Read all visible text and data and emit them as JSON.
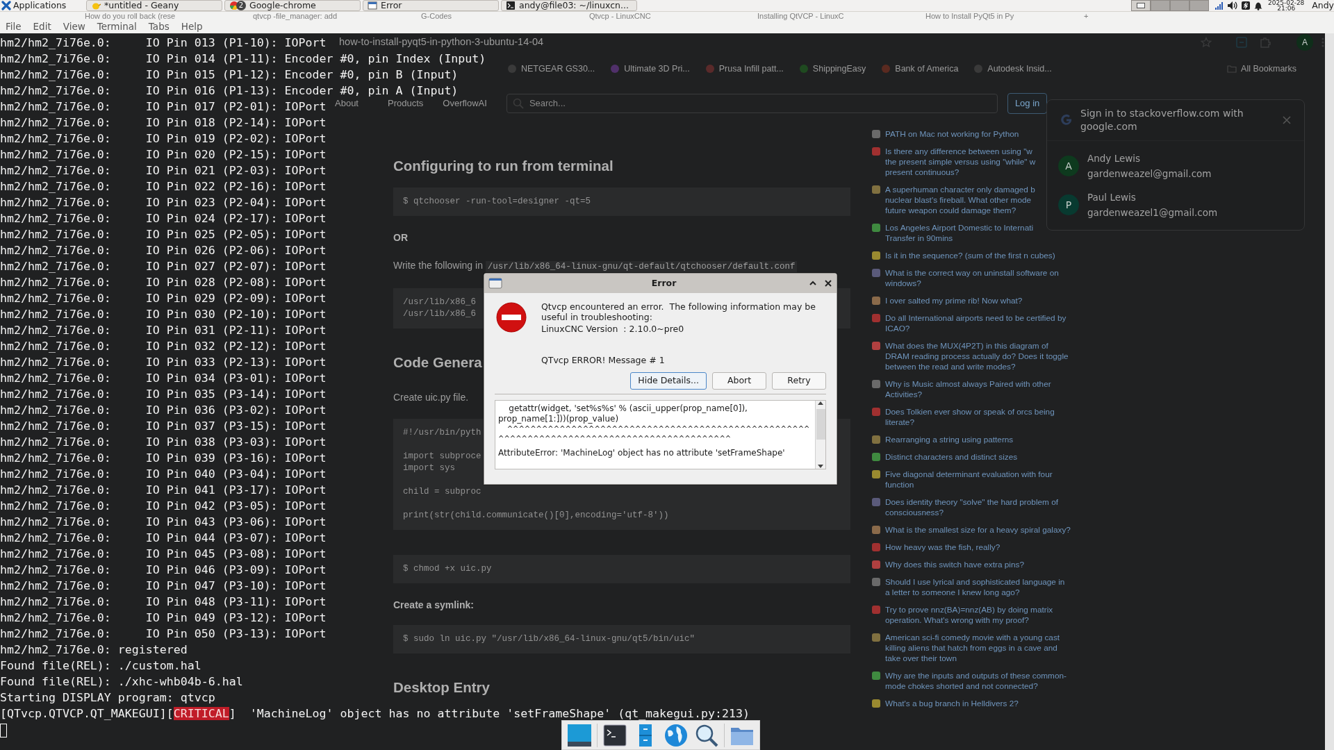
{
  "panel": {
    "menu_label": "Applications",
    "windows": [
      {
        "kind": "editor",
        "title": "*untitled - Geany"
      },
      {
        "kind": "browser",
        "title": "Google-chrome",
        "count": "2"
      },
      {
        "kind": "dialog",
        "title": "Error"
      },
      {
        "kind": "terminal",
        "title": "andy@file03: ~/linuxcn..."
      }
    ],
    "workspaces": [
      {
        "selected": true
      },
      {
        "selected": false
      },
      {
        "selected": false
      },
      {
        "selected": false
      }
    ],
    "date": "2025-02-28",
    "time": "21:06",
    "user": "Andy"
  },
  "browser": {
    "tabs": [
      "How do you roll back (rese",
      "qtvcp -file_manager: add",
      "G-Codes",
      "Qtvcp - LinuxCNC",
      "Installing QtVCP - LinuxC",
      "How to Install PyQt5 in Py"
    ],
    "new_tab": "+",
    "url": "how-to-install-pyqt5-in-python-3-ubuntu-14-04",
    "profile_initial": "A",
    "bookmarks": [
      "NETGEAR GS30...",
      "Ultimate 3D Pri...",
      "Prusa Infill patt...",
      "ShippingEasy",
      "Bank of America",
      "Autodesk Insid..."
    ],
    "all_bookmarks": "All Bookmarks",
    "site_nav": [
      "About",
      "Products",
      "OverflowAI"
    ],
    "search": {
      "placeholder": "Search..."
    },
    "login": "Log in",
    "article": [
      {
        "kind": "heading",
        "text": "Configuring to run from terminal"
      },
      {
        "kind": "code",
        "groups": [
          [
            "$ qtchooser -run-tool=designer -qt=5"
          ]
        ]
      },
      {
        "kind": "bold",
        "text": "OR"
      },
      {
        "kind": "paragraph",
        "text": "Write the following in ",
        "code": "/usr/lib/x86_64-linux-gnu/qt-default/qtchooser/default.conf"
      },
      {
        "kind": "code",
        "groups": [
          [
            "/usr/lib/x86_6",
            "/usr/lib/x86_6"
          ]
        ]
      },
      {
        "kind": "heading",
        "text": "Code Genera"
      },
      {
        "kind": "paragraph",
        "text": "Create uic.py file."
      },
      {
        "kind": "code",
        "groups": [
          [
            "#!/usr/bin/pyth"
          ],
          [
            "import subproce",
            "import sys"
          ],
          [
            "child = subproc"
          ],
          [
            "print(str(child.communicate()[0],encoding='utf-8'))"
          ]
        ]
      },
      {
        "kind": "code",
        "groups": [
          [
            "$ chmod +x uic.py"
          ]
        ]
      },
      {
        "kind": "bold",
        "text": "Create a symlink:"
      },
      {
        "kind": "code",
        "groups": [
          [
            "$ sudo ln uic.py \"/usr/lib/x86_64-linux-gnu/qt5/bin/uic\""
          ]
        ]
      },
      {
        "kind": "heading",
        "text": "Desktop Entry"
      }
    ],
    "related": [
      "PATH on Mac not working for Python",
      "Is there any difference between using \"w\nthe present simple versus using \"while\" w\npresent continuous?",
      "A superhuman character only damaged b\nnuclear blast's fireball. What other mode\nfuture weapon could damage them?",
      "Los Angeles Airport Domestic to Internati\nTransfer in 90mins",
      "Is it in the sequence? (sum of the first n cubes)",
      "What is the correct way on uninstall software on windows?",
      "I over salted my prime rib! Now what?",
      "Do all International airports need to be certified by ICAO?",
      "What does the MUX(4P2T) in this diagram of DRAM reading process actually do? Does it toggle between the read and write modes?",
      "Why is Music almost always Paired with other Activities?",
      "Does Tolkien ever show or speak of orcs being literate?",
      "Rearranging a string using patterns",
      "Distinct characters and distinct sizes",
      "Five diagonal determinant evaluation with four function",
      "Does identity theory \"solve\" the hard problem of consciousness?",
      "What is the smallest size for a heavy spiral galaxy?",
      "How heavy was the fish, really?",
      "Why does this switch have extra pins?",
      "Should I use lyrical and sophisticated language in a letter to someone I knew long ago?",
      "Try to prove nnz(BA)=nnz(AB) by doing matrix operation. What's wrong with my proof?",
      "American sci-fi comedy movie with a young cast killing aliens that hatch from eggs in a cave and take over their town",
      "Why are the inputs and outputs of these common-mode chokes shorted and not connected?",
      "What's a bug branch in Helldivers 2?"
    ],
    "signin": {
      "title": "Sign in to stackoverflow.com with google.com",
      "accounts": [
        {
          "initial": "A",
          "name": "Andy Lewis",
          "email": "gardenweazel@gmail.com",
          "color": "#0e3a1e"
        },
        {
          "initial": "P",
          "name": "Paul Lewis",
          "email": "gardenweazel1@gmail.com",
          "color": "#083a30"
        }
      ]
    }
  },
  "terminal": {
    "menu": [
      "File",
      "Edit",
      "View",
      "Terminal",
      "Tabs",
      "Help"
    ],
    "lines": [
      {
        "text": "hm2/hm2_7i76e.0:     IO Pin 013 (P1-10): IOPort"
      },
      {
        "text": "hm2/hm2_7i76e.0:     IO Pin 014 (P1-11): Encoder #0, pin Index (Input)"
      },
      {
        "text": "hm2/hm2_7i76e.0:     IO Pin 015 (P1-12): Encoder #0, pin B (Input)"
      },
      {
        "text": "hm2/hm2_7i76e.0:     IO Pin 016 (P1-13): Encoder #0, pin A (Input)"
      },
      {
        "text": "hm2/hm2_7i76e.0:     IO Pin 017 (P2-01): IOPort"
      },
      {
        "text": "hm2/hm2_7i76e.0:     IO Pin 018 (P2-14): IOPort"
      },
      {
        "text": "hm2/hm2_7i76e.0:     IO Pin 019 (P2-02): IOPort"
      },
      {
        "text": "hm2/hm2_7i76e.0:     IO Pin 020 (P2-15): IOPort"
      },
      {
        "text": "hm2/hm2_7i76e.0:     IO Pin 021 (P2-03): IOPort"
      },
      {
        "text": "hm2/hm2_7i76e.0:     IO Pin 022 (P2-16): IOPort"
      },
      {
        "text": "hm2/hm2_7i76e.0:     IO Pin 023 (P2-04): IOPort"
      },
      {
        "text": "hm2/hm2_7i76e.0:     IO Pin 024 (P2-17): IOPort"
      },
      {
        "text": "hm2/hm2_7i76e.0:     IO Pin 025 (P2-05): IOPort"
      },
      {
        "text": "hm2/hm2_7i76e.0:     IO Pin 026 (P2-06): IOPort"
      },
      {
        "text": "hm2/hm2_7i76e.0:     IO Pin 027 (P2-07): IOPort"
      },
      {
        "text": "hm2/hm2_7i76e.0:     IO Pin 028 (P2-08): IOPort"
      },
      {
        "text": "hm2/hm2_7i76e.0:     IO Pin 029 (P2-09): IOPort"
      },
      {
        "text": "hm2/hm2_7i76e.0:     IO Pin 030 (P2-10): IOPort"
      },
      {
        "text": "hm2/hm2_7i76e.0:     IO Pin 031 (P2-11): IOPort"
      },
      {
        "text": "hm2/hm2_7i76e.0:     IO Pin 032 (P2-12): IOPort"
      },
      {
        "text": "hm2/hm2_7i76e.0:     IO Pin 033 (P2-13): IOPort"
      },
      {
        "text": "hm2/hm2_7i76e.0:     IO Pin 034 (P3-01): IOPort"
      },
      {
        "text": "hm2/hm2_7i76e.0:     IO Pin 035 (P3-14): IOPort"
      },
      {
        "text": "hm2/hm2_7i76e.0:     IO Pin 036 (P3-02): IOPort"
      },
      {
        "text": "hm2/hm2_7i76e.0:     IO Pin 037 (P3-15): IOPort"
      },
      {
        "text": "hm2/hm2_7i76e.0:     IO Pin 038 (P3-03): IOPort"
      },
      {
        "text": "hm2/hm2_7i76e.0:     IO Pin 039 (P3-16): IOPort"
      },
      {
        "text": "hm2/hm2_7i76e.0:     IO Pin 040 (P3-04): IOPort"
      },
      {
        "text": "hm2/hm2_7i76e.0:     IO Pin 041 (P3-17): IOPort"
      },
      {
        "text": "hm2/hm2_7i76e.0:     IO Pin 042 (P3-05): IOPort"
      },
      {
        "text": "hm2/hm2_7i76e.0:     IO Pin 043 (P3-06): IOPort"
      },
      {
        "text": "hm2/hm2_7i76e.0:     IO Pin 044 (P3-07): IOPort"
      },
      {
        "text": "hm2/hm2_7i76e.0:     IO Pin 045 (P3-08): IOPort"
      },
      {
        "text": "hm2/hm2_7i76e.0:     IO Pin 046 (P3-09): IOPort"
      },
      {
        "text": "hm2/hm2_7i76e.0:     IO Pin 047 (P3-10): IOPort"
      },
      {
        "text": "hm2/hm2_7i76e.0:     IO Pin 048 (P3-11): IOPort"
      },
      {
        "text": "hm2/hm2_7i76e.0:     IO Pin 049 (P3-12): IOPort"
      },
      {
        "text": "hm2/hm2_7i76e.0:     IO Pin 050 (P3-13): IOPort"
      },
      {
        "text": "hm2/hm2_7i76e.0: registered"
      },
      {
        "text": "Found file(REL): ./custom.hal"
      },
      {
        "text": "Found file(REL): ./xhc-whb04b-6.hal"
      },
      {
        "text": "Starting DISPLAY program: qtvcp"
      },
      {
        "segments": [
          {
            "text": "[QTvcp.QTVCP.QT_MAKEGUI][",
            "highlight": false
          },
          {
            "text": "CRITICAL",
            "highlight": true
          },
          {
            "text": "]  'MachineLog' object has no attribute 'setFrameShape' (qt_makegui.py:213)",
            "highlight": false
          }
        ]
      }
    ],
    "cursor": true
  },
  "dialog": {
    "title": "Error",
    "message": "Qtvcp encountered an error.  The following information may be useful in troubleshooting:",
    "version": "LinuxCNC Version  : 2.10.0~pre0",
    "error": "QTvcp ERROR! Message # 1",
    "buttons": [
      {
        "label": "Hide Details...",
        "default": true
      },
      {
        "label": "Abort",
        "default": false
      },
      {
        "label": "Retry",
        "default": false
      }
    ],
    "details": [
      "    getattr(widget, 'set%s%s' % (ascii_upper(prop_name[0]), prop_name[1:]))(prop_value)",
      "    ^^^^^^^^^^^^^^^^^^^^^^^^^^^^^^^^^^^^^^^^^^^^^^^^^^^^^^^^^^^^^^^^^^^^^^^^^^^^^^^^^^^^^^^^^^^^",
      "AttributeError: 'MachineLog' object has no attribute 'setFrameShape'"
    ]
  },
  "dock": [
    {
      "kind": "desktop"
    },
    {
      "kind": "terminal"
    },
    {
      "kind": "cabinet"
    },
    {
      "kind": "globe"
    },
    {
      "kind": "magnifier"
    },
    {
      "kind": "folder"
    }
  ]
}
